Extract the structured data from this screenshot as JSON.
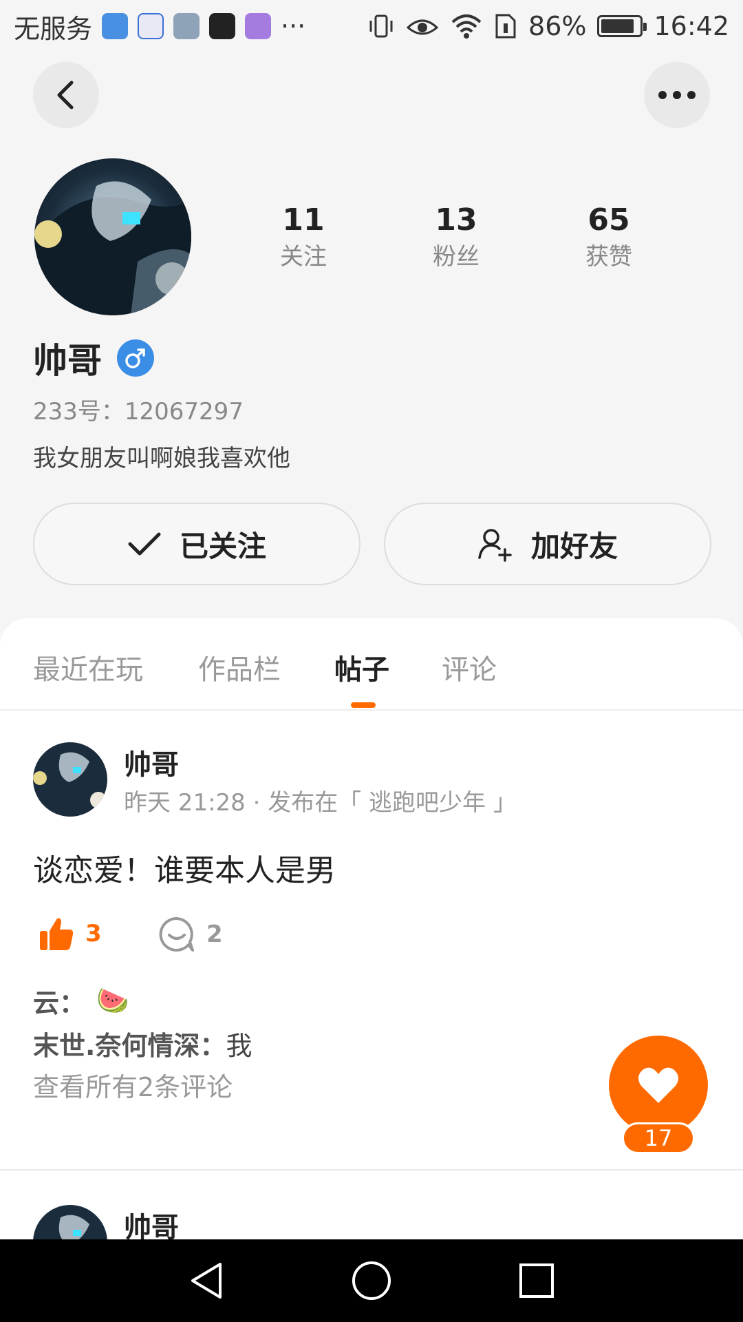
{
  "status_bar": {
    "carrier": "无服务",
    "more": "···",
    "battery": "86%",
    "battery_level": 0.86,
    "time": "16:42"
  },
  "profile": {
    "stats": [
      {
        "num": "11",
        "label": "关注"
      },
      {
        "num": "13",
        "label": "粉丝"
      },
      {
        "num": "65",
        "label": "获赞"
      }
    ],
    "name": "帅哥",
    "id_text": "233号：12067297",
    "bio": "我女朋友叫啊娘我喜欢他",
    "follow_label": "已关注",
    "add_friend_label": "加好友"
  },
  "tabs": [
    {
      "label": "最近在玩",
      "active": false
    },
    {
      "label": "作品栏",
      "active": false
    },
    {
      "label": "帖子",
      "active": true
    },
    {
      "label": "评论",
      "active": false
    }
  ],
  "post": {
    "author": "帅哥",
    "meta": "昨天 21:28 · 发布在「 逃跑吧少年 」",
    "text": "谈恋爱！谁要本人是男",
    "likes": "3",
    "comments": "2",
    "comment_list": [
      {
        "user": "云：",
        "text": "🍉"
      },
      {
        "user": "末世.奈何情深：",
        "text": "我"
      }
    ],
    "view_all": "查看所有2条评论"
  },
  "post2": {
    "author": "帅哥"
  },
  "fab": {
    "count": "17"
  },
  "colors": {
    "accent": "#ff6a00",
    "gender_blue": "#3a8ee6"
  }
}
